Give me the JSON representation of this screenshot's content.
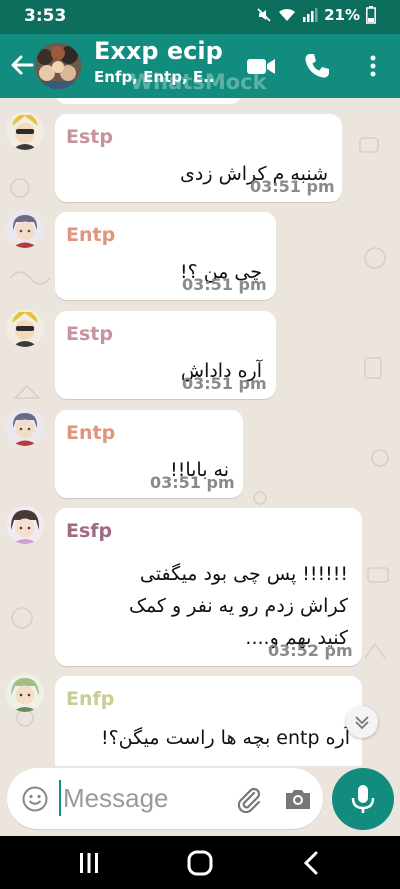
{
  "status_bar": {
    "time": "3:53",
    "battery": "21%"
  },
  "header": {
    "title": "Exxp ecip",
    "subtitle": "Enfp, Entp, E..",
    "watermark": "WhatsMock"
  },
  "messages": [
    {
      "sender": "Estp",
      "sender_color": "#c7939c",
      "avatar": "estp",
      "lines": [
        "شنبه م کراش زدی"
      ],
      "time": "03:51 pm"
    },
    {
      "sender": "Entp",
      "sender_color": "#e0967e",
      "avatar": "entp",
      "lines": [
        "چی من ؟!"
      ],
      "time": "03:51 pm"
    },
    {
      "sender": "Estp",
      "sender_color": "#c7939c",
      "avatar": "estp",
      "lines": [
        "آره داداش"
      ],
      "time": "03:51 pm"
    },
    {
      "sender": "Entp",
      "sender_color": "#e0967e",
      "avatar": "entp",
      "lines": [
        "نه بابا!!"
      ],
      "time": "03:51 pm"
    },
    {
      "sender": "Esfp",
      "sender_color": "#9e6b83",
      "avatar": "esfp",
      "lines": [
        "!!!!!! پس چی بود میگفتی",
        "کراش زدم رو یه نفر و کمک",
        "کنید بهم و...."
      ],
      "time": "03:52 pm"
    },
    {
      "sender": "Enfp",
      "sender_color": "#c9cc95",
      "avatar": "enfp",
      "lines": [
        "آره entp بچه ها راست میگن؟!"
      ],
      "time": ""
    }
  ],
  "composer": {
    "placeholder": "Message"
  },
  "colors": {
    "header": "#128c7e",
    "status_bar": "#0e6e5e",
    "background": "#ece5dd"
  },
  "icons": [
    "back-arrow-icon",
    "video-call-icon",
    "phone-icon",
    "more-options-icon",
    "emoji-icon",
    "attach-icon",
    "camera-icon",
    "mic-icon",
    "chevron-down-icon"
  ]
}
